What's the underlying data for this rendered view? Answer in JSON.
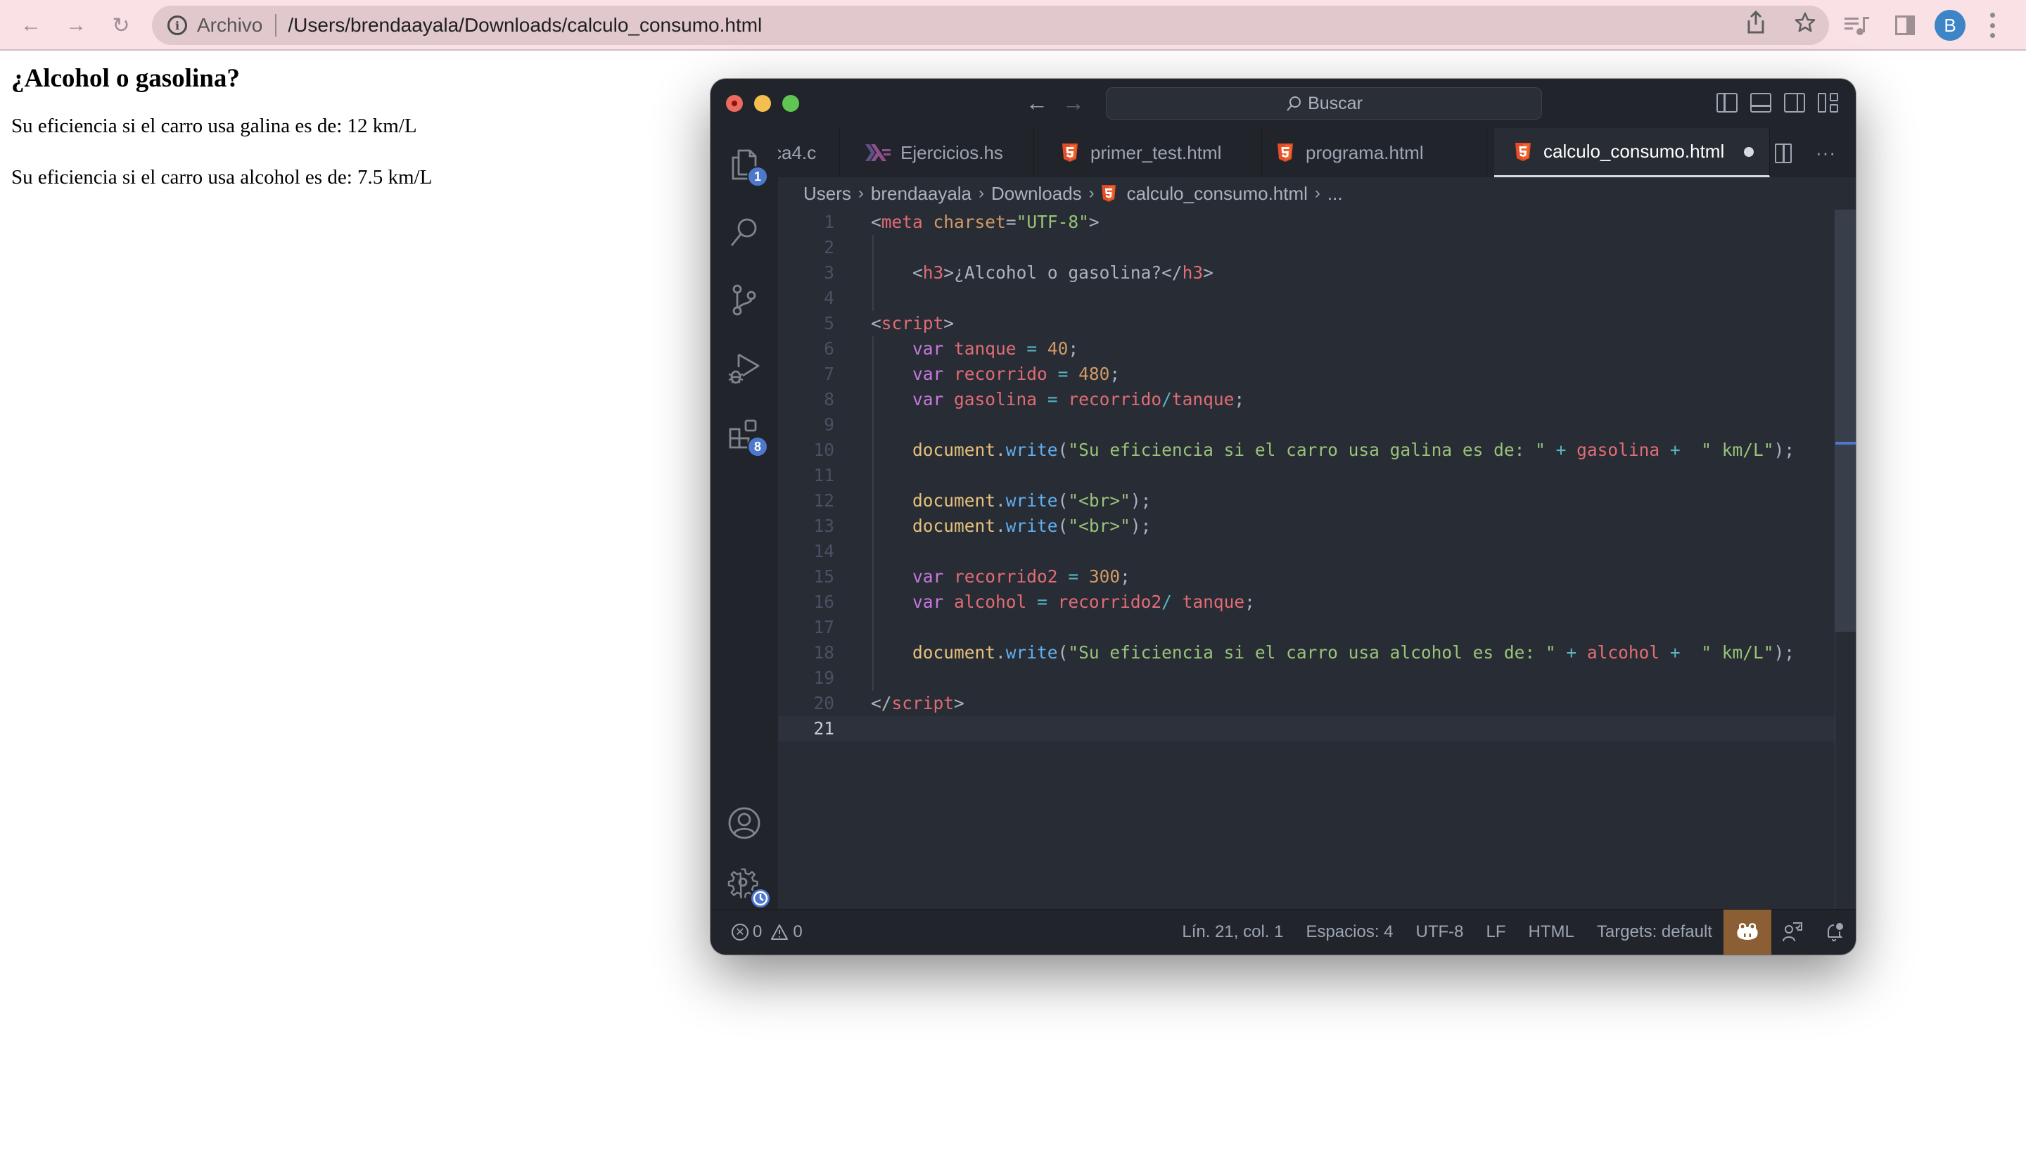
{
  "browser": {
    "nav": {
      "back": "←",
      "forward": "→",
      "reload": "↻"
    },
    "omnibox": {
      "scheme_label": "Archivo",
      "url": "/Users/brendaayala/Downloads/calculo_consumo.html"
    },
    "avatar_initial": "B",
    "colors": {
      "toolbar": "#f9e1e6",
      "omnibox": "#e0c8cc",
      "avatar": "#3d85c6"
    }
  },
  "page": {
    "heading": "¿Alcohol o gasolina?",
    "lines": [
      "Su eficiencia si el carro usa galina es de: 12 km/L",
      "Su eficiencia si el carro usa alcohol es de: 7.5 km/L"
    ]
  },
  "vscode": {
    "title_nav": {
      "back": "←",
      "forward": "→"
    },
    "command_center": {
      "icon": "⌕",
      "label": "Buscar"
    },
    "activity_badges": {
      "explorer": "1",
      "extensions": "8"
    },
    "tabs": [
      {
        "label": "ca4.c",
        "icon": "c-file-icon",
        "active": false
      },
      {
        "label": "Ejercicios.hs",
        "icon": "haskell-icon",
        "active": false
      },
      {
        "label": "primer_test.html",
        "icon": "html5-icon",
        "active": false
      },
      {
        "label": "programa.html",
        "icon": "html5-icon",
        "active": false
      },
      {
        "label": "calculo_consumo.html",
        "icon": "html5-icon",
        "active": true,
        "dirty": true
      }
    ],
    "tab_more": "···",
    "breadcrumb": [
      "Users",
      "brendaayala",
      "Downloads",
      "calculo_consumo.html",
      "..."
    ],
    "breadcrumb_sep": "›",
    "code": {
      "current_line": 21,
      "line_numbers": [
        "1",
        "2",
        "3",
        "4",
        "5",
        "6",
        "7",
        "8",
        "9",
        "10",
        "11",
        "12",
        "13",
        "14",
        "15",
        "16",
        "17",
        "18",
        "19",
        "20",
        "21"
      ],
      "lines": [
        [
          [
            "punc",
            "<"
          ],
          [
            "tag",
            "meta"
          ],
          [
            "text",
            " "
          ],
          [
            "attr",
            "charset"
          ],
          [
            "punc",
            "="
          ],
          [
            "str",
            "\"UTF-8\""
          ],
          [
            "punc",
            ">"
          ]
        ],
        [],
        [
          [
            "text",
            "    "
          ],
          [
            "punc",
            "<"
          ],
          [
            "tag",
            "h3"
          ],
          [
            "punc",
            ">"
          ],
          [
            "text",
            "¿Alcohol o gasolina?"
          ],
          [
            "punc",
            "</"
          ],
          [
            "tag",
            "h3"
          ],
          [
            "punc",
            ">"
          ]
        ],
        [],
        [
          [
            "punc",
            "<"
          ],
          [
            "tag",
            "script"
          ],
          [
            "punc",
            ">"
          ]
        ],
        [
          [
            "text",
            "    "
          ],
          [
            "kw",
            "var"
          ],
          [
            "text",
            " "
          ],
          [
            "var",
            "tanque"
          ],
          [
            "text",
            " "
          ],
          [
            "op",
            "="
          ],
          [
            "text",
            " "
          ],
          [
            "num",
            "40"
          ],
          [
            "punc",
            ";"
          ]
        ],
        [
          [
            "text",
            "    "
          ],
          [
            "kw",
            "var"
          ],
          [
            "text",
            " "
          ],
          [
            "var",
            "recorrido"
          ],
          [
            "text",
            " "
          ],
          [
            "op",
            "="
          ],
          [
            "text",
            " "
          ],
          [
            "num",
            "480"
          ],
          [
            "punc",
            ";"
          ]
        ],
        [
          [
            "text",
            "    "
          ],
          [
            "kw",
            "var"
          ],
          [
            "text",
            " "
          ],
          [
            "var",
            "gasolina"
          ],
          [
            "text",
            " "
          ],
          [
            "op",
            "="
          ],
          [
            "text",
            " "
          ],
          [
            "var",
            "recorrido"
          ],
          [
            "op",
            "/"
          ],
          [
            "var",
            "tanque"
          ],
          [
            "punc",
            ";"
          ]
        ],
        [],
        [
          [
            "text",
            "    "
          ],
          [
            "obj",
            "document"
          ],
          [
            "punc",
            "."
          ],
          [
            "fn",
            "write"
          ],
          [
            "punc",
            "("
          ],
          [
            "str",
            "\"Su eficiencia si el carro usa galina es de: \""
          ],
          [
            "text",
            " "
          ],
          [
            "op",
            "+"
          ],
          [
            "text",
            " "
          ],
          [
            "var",
            "gasolina"
          ],
          [
            "text",
            " "
          ],
          [
            "op",
            "+"
          ],
          [
            "text",
            "  "
          ],
          [
            "str",
            "\" km/L\""
          ],
          [
            "punc",
            ");"
          ]
        ],
        [],
        [
          [
            "text",
            "    "
          ],
          [
            "obj",
            "document"
          ],
          [
            "punc",
            "."
          ],
          [
            "fn",
            "write"
          ],
          [
            "punc",
            "("
          ],
          [
            "str",
            "\"<br>\""
          ],
          [
            "punc",
            ");"
          ]
        ],
        [
          [
            "text",
            "    "
          ],
          [
            "obj",
            "document"
          ],
          [
            "punc",
            "."
          ],
          [
            "fn",
            "write"
          ],
          [
            "punc",
            "("
          ],
          [
            "str",
            "\"<br>\""
          ],
          [
            "punc",
            ");"
          ]
        ],
        [],
        [
          [
            "text",
            "    "
          ],
          [
            "kw",
            "var"
          ],
          [
            "text",
            " "
          ],
          [
            "var",
            "recorrido2"
          ],
          [
            "text",
            " "
          ],
          [
            "op",
            "="
          ],
          [
            "text",
            " "
          ],
          [
            "num",
            "300"
          ],
          [
            "punc",
            ";"
          ]
        ],
        [
          [
            "text",
            "    "
          ],
          [
            "kw",
            "var"
          ],
          [
            "text",
            " "
          ],
          [
            "var",
            "alcohol"
          ],
          [
            "text",
            " "
          ],
          [
            "op",
            "="
          ],
          [
            "text",
            " "
          ],
          [
            "var",
            "recorrido2"
          ],
          [
            "op",
            "/"
          ],
          [
            "text",
            " "
          ],
          [
            "var",
            "tanque"
          ],
          [
            "punc",
            ";"
          ]
        ],
        [],
        [
          [
            "text",
            "    "
          ],
          [
            "obj",
            "document"
          ],
          [
            "punc",
            "."
          ],
          [
            "fn",
            "write"
          ],
          [
            "punc",
            "("
          ],
          [
            "str",
            "\"Su eficiencia si el carro usa alcohol es de: \""
          ],
          [
            "text",
            " "
          ],
          [
            "op",
            "+"
          ],
          [
            "text",
            " "
          ],
          [
            "var",
            "alcohol"
          ],
          [
            "text",
            " "
          ],
          [
            "op",
            "+"
          ],
          [
            "text",
            "  "
          ],
          [
            "str",
            "\" km/L\""
          ],
          [
            "punc",
            ");"
          ]
        ],
        [],
        [
          [
            "punc",
            "</"
          ],
          [
            "tag",
            "script"
          ],
          [
            "punc",
            ">"
          ]
        ],
        []
      ]
    },
    "status": {
      "errors": "0",
      "warnings": "0",
      "position": "Lín. 21, col. 1",
      "indent": "Espacios: 4",
      "encoding": "UTF-8",
      "eol": "LF",
      "language": "HTML",
      "targets": "Targets: default"
    },
    "colors": {
      "window_bg": "#21252b",
      "editor_bg": "#282c34",
      "accent_badge": "#4d78cc",
      "copilot_bg": "#8b5e34"
    }
  }
}
